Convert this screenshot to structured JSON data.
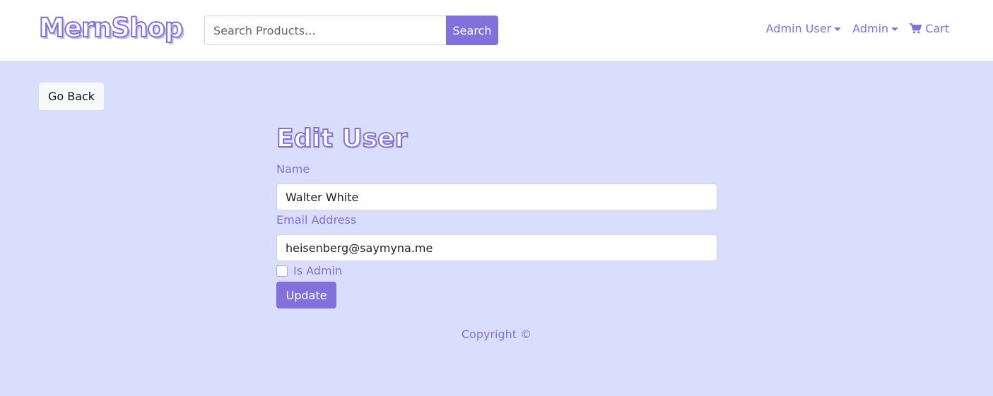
{
  "navbar": {
    "brand": "MernShop",
    "search": {
      "placeholder": "Search Products...",
      "value": "",
      "button_label": "Search"
    },
    "links": [
      {
        "label": "Admin User",
        "dropdown": true
      },
      {
        "label": "Admin",
        "dropdown": true
      },
      {
        "label": "Cart",
        "icon": "cart-icon"
      }
    ]
  },
  "main": {
    "go_back_label": "Go Back",
    "title": "Edit User",
    "form": {
      "name_label": "Name",
      "name_value": "Walter White",
      "email_label": "Email Address",
      "email_value": "heisenberg@saymyna.me",
      "is_admin_label": "Is Admin",
      "is_admin_checked": false,
      "submit_label": "Update"
    }
  },
  "footer": {
    "copyright": "Copyright ©"
  },
  "colors": {
    "accent": "#8270dd",
    "background": "#d9defd",
    "navbar": "#ffffff"
  }
}
